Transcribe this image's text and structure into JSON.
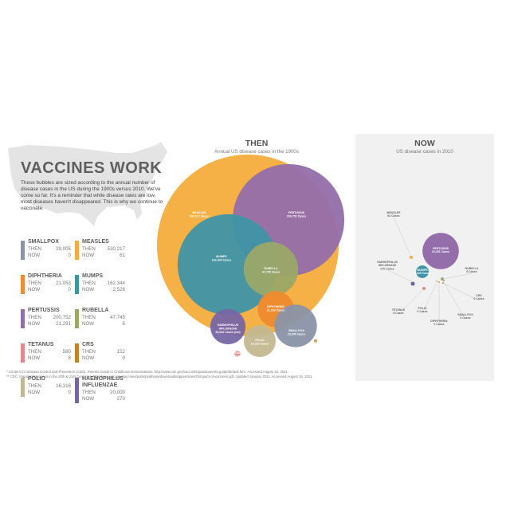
{
  "title": "VACCINES WORK",
  "intro": "These bubbles are sized according to the annual number of disease cases in the US during the 1900s versus 2010. We've come so far. It's a reminder that while disease rates are low, most diseases haven't disappeared. This is why we continue to vaccinate.",
  "then_label": "THEN",
  "now_label": "NOW",
  "then_heading": "THEN",
  "then_subtitle": "Annual US disease cases in the 1900s",
  "now_heading": "NOW",
  "now_subtitle": "US disease cases in 2010",
  "footnotes": [
    "* Centers for Disease Control and Prevention (CDC). Parents Guide to Childhood Immunizations. http://www.cdc.gov/vaccines/pubs/parents-guide/default.htm. Accessed August 15, 2011.",
    "** CDC. Impact of Vaccines in the 20th & 21st Centuries. http://www.cdc.gov/vaccines/pubs/pinkbook/downloads/appendices/G/impact-of-vaccines.pdf. Updated January 2011. Accessed August 15, 2011."
  ],
  "chart_data": {
    "type": "bubble",
    "series": [
      {
        "name": "SMALLPOX",
        "color": "#8a94a8",
        "then": 29005,
        "now": 0,
        "then_label": "29,005 Cases",
        "now_label": "0 Cases"
      },
      {
        "name": "MEASLES",
        "color": "#f4ac3c",
        "then": 530217,
        "now": 61,
        "then_label": "530,217 Cases",
        "now_label": "61 Cases"
      },
      {
        "name": "DIPHTHERIA",
        "color": "#ee8a2f",
        "then": 21053,
        "now": 0,
        "then_label": "21,053 Cases",
        "now_label": "0 Cases"
      },
      {
        "name": "MUMPS",
        "color": "#3f93a6",
        "then": 162344,
        "now": 2528,
        "then_label": "162,344 Cases",
        "now_label": "2,528 Cases"
      },
      {
        "name": "PERTUSSIS",
        "color": "#946eaa",
        "then": 200752,
        "now": 21291,
        "then_label": "200,752 Cases",
        "now_label": "21,291 Cases"
      },
      {
        "name": "RUBELLA",
        "color": "#9ba868",
        "then": 47745,
        "now": 6,
        "then_label": "47,745 Cases",
        "now_label": "6 Cases"
      },
      {
        "name": "TETANUS",
        "color": "#de8a8a",
        "then": 580,
        "now": 8,
        "then_label": "580 Cases",
        "now_label": "8 Cases"
      },
      {
        "name": "CRS",
        "color": "#bf8424",
        "then": 152,
        "now": 0,
        "then_label": "152 Cases",
        "now_label": "0 Cases"
      },
      {
        "name": "POLIO",
        "color": "#c3b890",
        "then": 16316,
        "now": 0,
        "then_label": "16,316 Cases",
        "now_label": "0 Cases"
      },
      {
        "name": "HAEMOPHILUS INFLUENZAE",
        "color": "#7766a5",
        "then": 20000,
        "now": 270,
        "then_label": "20,000 Cases (est)",
        "now_label": "270 Cases"
      }
    ]
  }
}
